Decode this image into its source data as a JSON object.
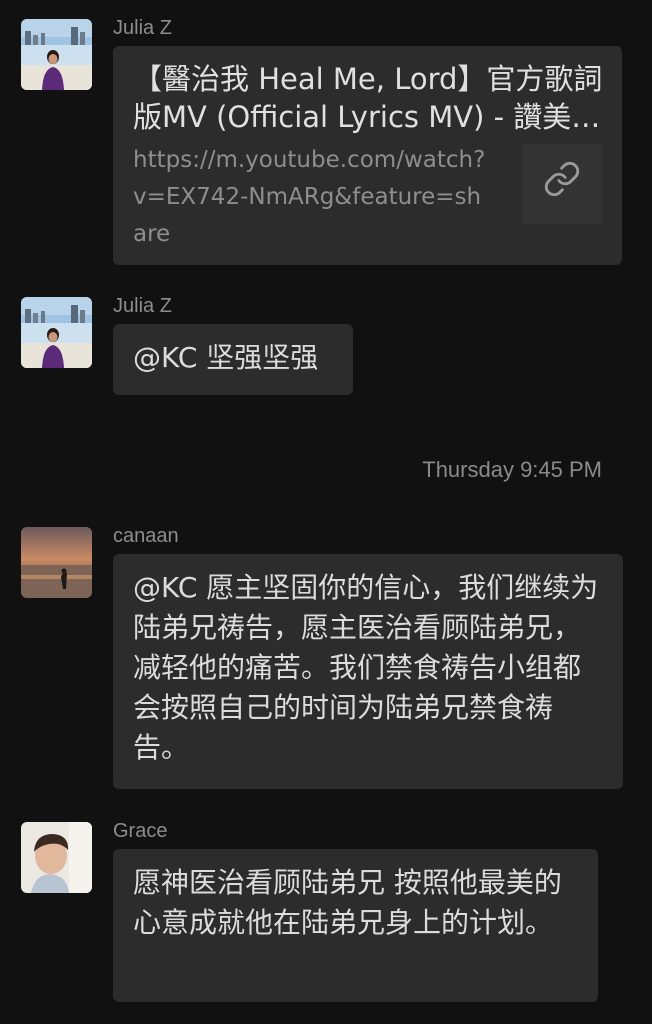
{
  "messages": [
    {
      "sender": "Julia Z",
      "link": {
        "title": "【醫治我 Heal Me, Lord】官方歌詞版MV (Official Lyrics MV) - 讚美之泉",
        "url": "https://m.youtube.com/watch?v=EX742-NmARg&feature=share",
        "icon": "link-icon"
      }
    },
    {
      "sender": "Julia Z",
      "text": "@KC 坚强坚强"
    },
    {
      "sender": "canaan",
      "text": "@KC 愿主坚固你的信心，我们继续为陆弟兄祷告，愿主医治看顾陆弟兄，减轻他的痛苦。我们禁食祷告小组都会按照自己的时间为陆弟兄禁食祷告。"
    },
    {
      "sender": "Grace",
      "text": "愿神医治看顾陆弟兄 按照他最美的心意成就他在陆弟兄身上的计划。"
    }
  ],
  "timestamp": "Thursday 9:45 PM",
  "colors": {
    "background": "#111111",
    "bubble": "#2c2c2c",
    "sender_name": "#8d8d8d",
    "message_text": "#dcdcdc"
  }
}
